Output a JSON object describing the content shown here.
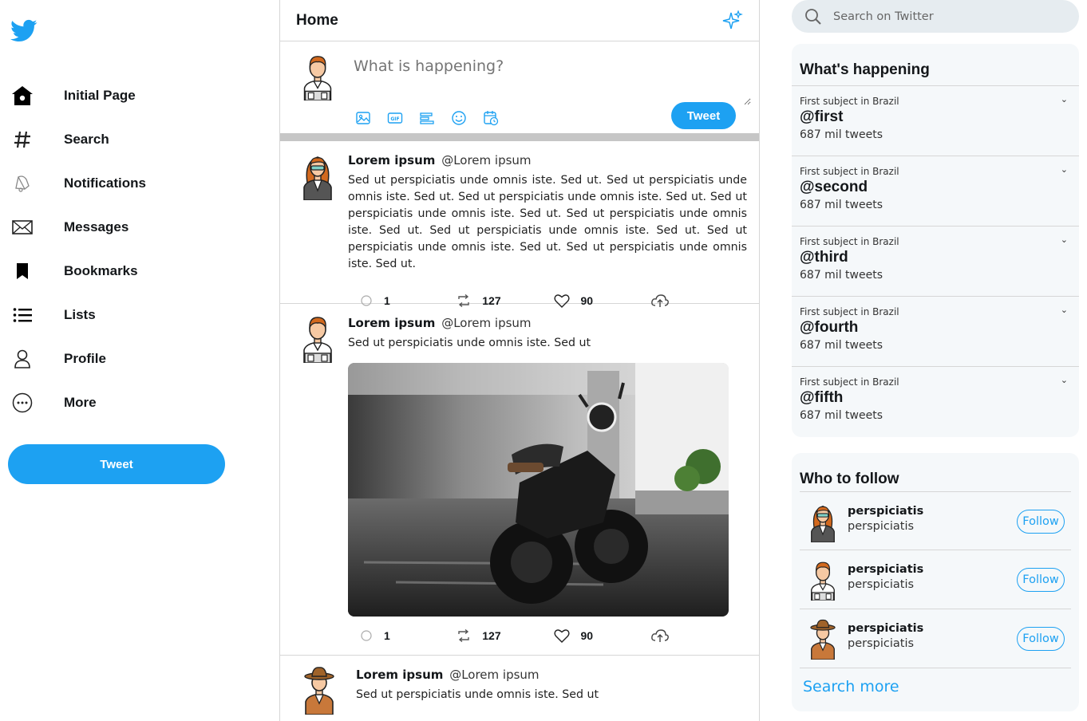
{
  "sidebar": {
    "items": [
      {
        "label": "Initial Page",
        "icon": "home-icon"
      },
      {
        "label": "Search",
        "icon": "hashtag-icon"
      },
      {
        "label": "Notifications",
        "icon": "bell-icon"
      },
      {
        "label": "Messages",
        "icon": "envelope-icon"
      },
      {
        "label": "Bookmarks",
        "icon": "bookmark-icon"
      },
      {
        "label": "Lists",
        "icon": "list-icon"
      },
      {
        "label": "Profile",
        "icon": "user-icon"
      },
      {
        "label": "More",
        "icon": "more-icon"
      }
    ],
    "tweet_button": "Tweet"
  },
  "header": {
    "title": "Home"
  },
  "composer": {
    "placeholder": "What is happening?",
    "tweet_button": "Tweet"
  },
  "tweets": [
    {
      "name": "Lorem ipsum",
      "handle": "@Lorem ipsum",
      "text": "Sed ut perspiciatis unde omnis iste. Sed ut. Sed ut perspiciatis unde omnis iste. Sed ut. Sed ut perspiciatis unde omnis iste. Sed ut. Sed ut perspiciatis unde omnis iste. Sed ut. Sed ut perspiciatis unde omnis iste. Sed ut. Sed ut perspiciatis unde omnis iste. Sed ut. Sed ut perspiciatis unde omnis iste. Sed ut. Sed ut perspiciatis unde omnis iste. Sed ut.",
      "replies": "1",
      "retweets": "127",
      "likes": "90"
    },
    {
      "name": "Lorem ipsum",
      "handle": "@Lorem ipsum",
      "text": "Sed ut perspiciatis unde omnis iste. Sed ut",
      "replies": "1",
      "retweets": "127",
      "likes": "90"
    },
    {
      "name": "Lorem ipsum",
      "handle": "@Lorem ipsum",
      "text": "Sed ut perspiciatis unde omnis iste. Sed ut"
    }
  ],
  "search": {
    "placeholder": "Search on Twitter"
  },
  "trends": {
    "title": "What's happening",
    "items": [
      {
        "subject": "First subject in Brazil",
        "tag": "@first",
        "count": "687 mil tweets"
      },
      {
        "subject": "First subject in Brazil",
        "tag": "@second",
        "count": "687 mil tweets"
      },
      {
        "subject": "First subject in Brazil",
        "tag": "@third",
        "count": "687 mil tweets"
      },
      {
        "subject": "First subject in Brazil",
        "tag": "@fourth",
        "count": "687 mil tweets"
      },
      {
        "subject": "First subject in Brazil",
        "tag": "@fifth",
        "count": "687 mil tweets"
      }
    ]
  },
  "who_to_follow": {
    "title": "Who to follow",
    "users": [
      {
        "name": "perspiciatis",
        "handle": "perspiciatis",
        "button": "Follow"
      },
      {
        "name": "perspiciatis",
        "handle": "perspiciatis",
        "button": "Follow"
      },
      {
        "name": "perspiciatis",
        "handle": "perspiciatis",
        "button": "Follow"
      }
    ],
    "search_more": "Search more"
  },
  "colors": {
    "accent": "#1da1f2",
    "panel_bg": "#f5f8fa",
    "separator": "#c6c6c6"
  }
}
